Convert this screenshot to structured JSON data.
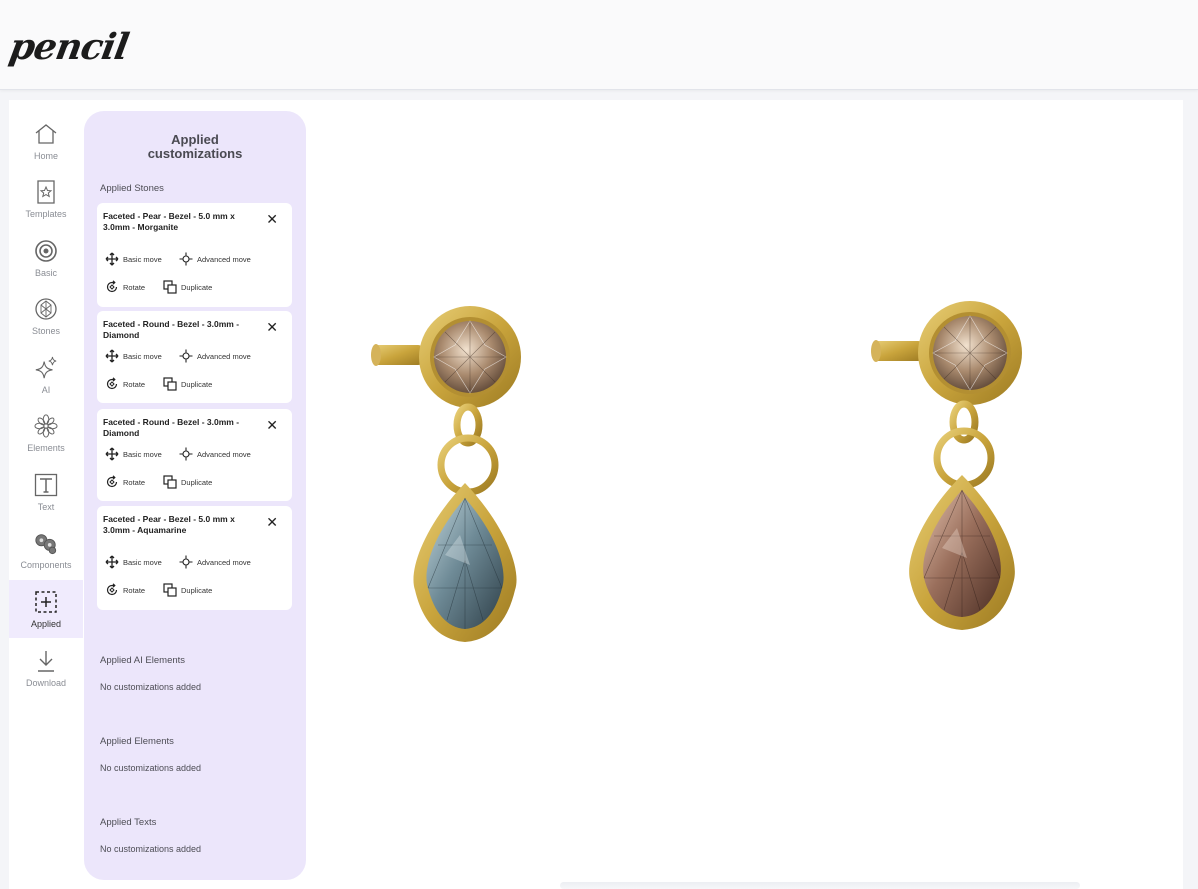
{
  "app": {
    "logo": "pencil"
  },
  "nav": {
    "items": [
      {
        "label": "Home",
        "icon": "home-icon"
      },
      {
        "label": "Templates",
        "icon": "templates-icon"
      },
      {
        "label": "Basic",
        "icon": "basic-icon"
      },
      {
        "label": "Stones",
        "icon": "stones-icon"
      },
      {
        "label": "AI",
        "icon": "ai-sparkle-icon"
      },
      {
        "label": "Elements",
        "icon": "elements-icon"
      },
      {
        "label": "Text",
        "icon": "text-icon"
      },
      {
        "label": "Components",
        "icon": "components-icon"
      },
      {
        "label": "Applied",
        "icon": "applied-icon"
      },
      {
        "label": "Download",
        "icon": "download-icon"
      }
    ],
    "active": "Applied"
  },
  "panel": {
    "title": "Applied customizations",
    "stones_heading": "Applied Stones",
    "actions": {
      "basic_move": "Basic move",
      "advanced_move": "Advanced move",
      "rotate": "Rotate",
      "duplicate": "Duplicate"
    },
    "stones": [
      {
        "name": "Faceted - Pear - Bezel - 5.0 mm x 3.0mm - Morganite"
      },
      {
        "name": "Faceted - Round - Bezel - 3.0mm - Diamond"
      },
      {
        "name": "Faceted - Round - Bezel - 3.0mm - Diamond"
      },
      {
        "name": "Faceted - Pear - Bezel - 5.0 mm x 3.0mm - Aquamarine"
      }
    ],
    "ai_heading": "Applied AI Elements",
    "ai_empty": "No customizations added",
    "elements_heading": "Applied Elements",
    "elements_empty": "No customizations added",
    "texts_heading": "Applied Texts",
    "texts_empty": "No customizations added"
  },
  "colors": {
    "gold": "#c9a43c",
    "panel_bg": "#ece6fb",
    "aquamarine": "#7f9aa6",
    "morganite": "#a57a68"
  }
}
